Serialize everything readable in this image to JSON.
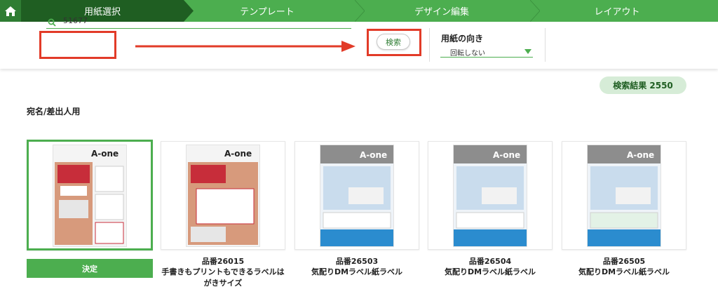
{
  "nav": {
    "home_icon": "home-icon",
    "steps": [
      "用紙選択",
      "テンプレート",
      "デザイン編集",
      "レイアウト"
    ],
    "active_step": 0
  },
  "search": {
    "value": "51677",
    "button_label": "検索"
  },
  "orientation": {
    "title": "用紙の向き",
    "selected": "回転しない"
  },
  "results": {
    "label": "検索結果 2550"
  },
  "category": "宛名/差出人用",
  "products": [
    {
      "number": "",
      "name": "",
      "selected": true
    },
    {
      "number": "品番26015",
      "name": "手書きもプリントもできるラベルはがきサイズ",
      "selected": false
    },
    {
      "number": "品番26503",
      "name": "気配りDMラベル紙ラベル",
      "selected": false
    },
    {
      "number": "品番26504",
      "name": "気配りDMラベル紙ラベル",
      "selected": false
    },
    {
      "number": "品番26505",
      "name": "気配りDMラベル紙ラベル",
      "selected": false
    }
  ],
  "decide_button": "決定",
  "colors": {
    "brand_green": "#4cae4f",
    "dark_green": "#1f5e22",
    "highlight_red": "#e23b28",
    "badge_bg": "#d6ecd7"
  }
}
